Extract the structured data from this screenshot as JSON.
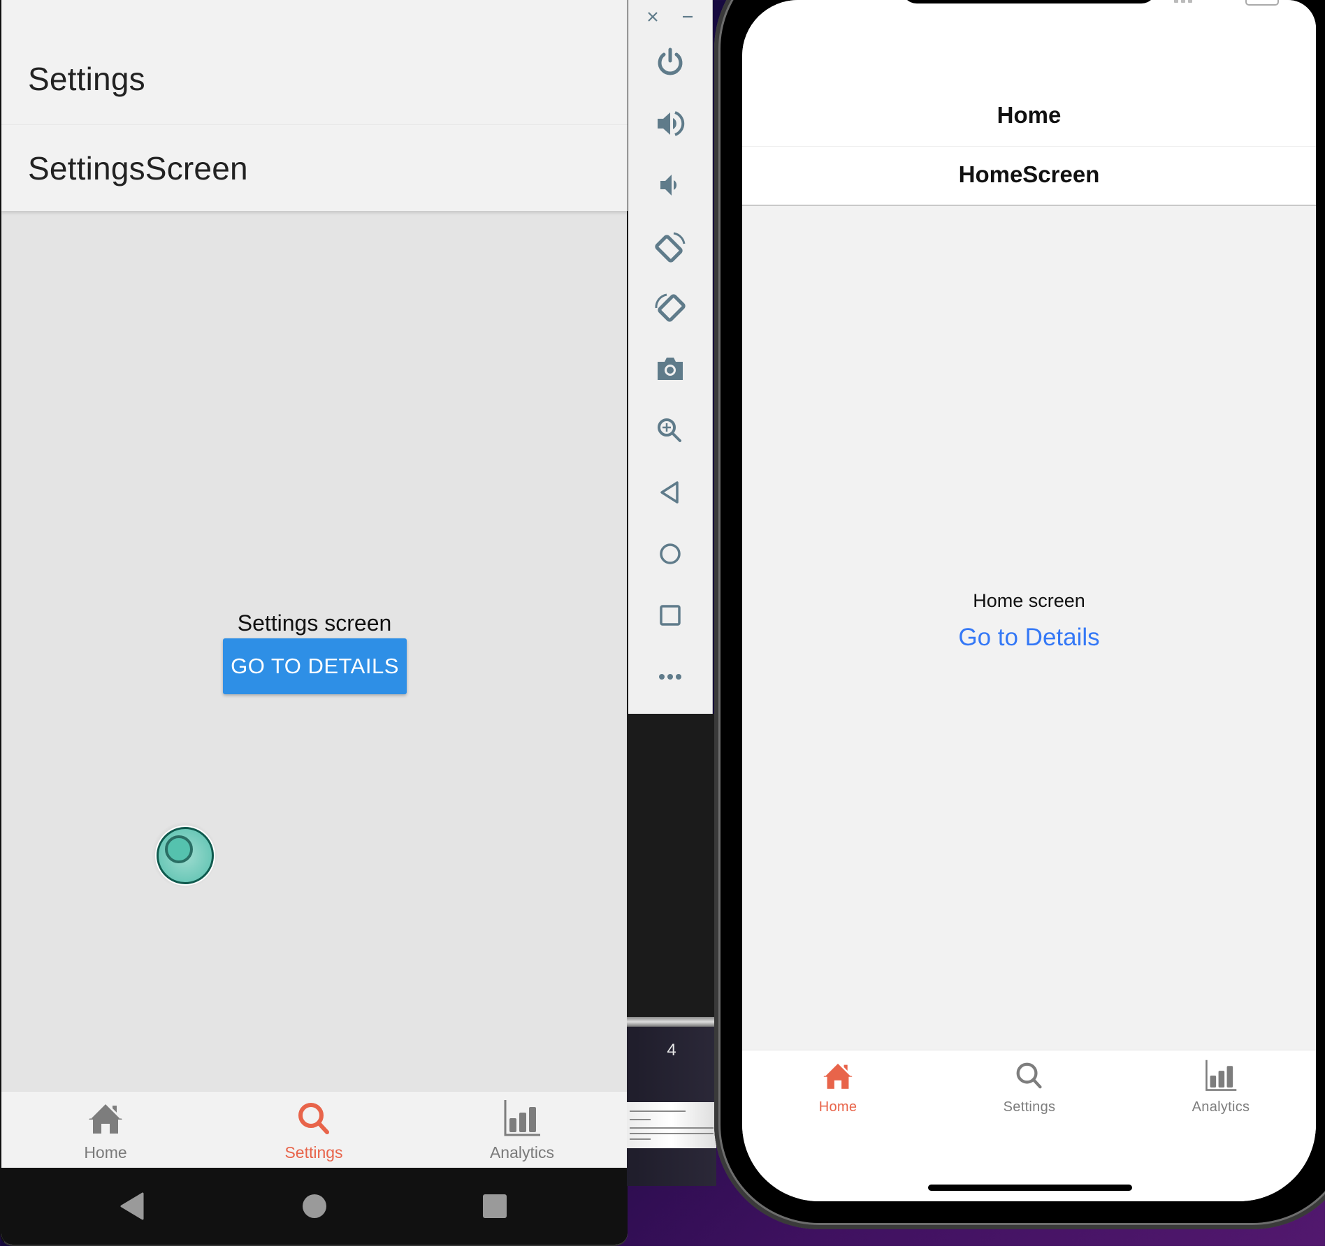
{
  "android": {
    "header": {
      "title": "Settings",
      "subtitle": "SettingsScreen"
    },
    "content": {
      "screen_label": "Settings screen",
      "go_button_label": "GO TO DETAILS"
    },
    "tabs": [
      {
        "label": "Home",
        "icon": "home-icon",
        "active": false
      },
      {
        "label": "Settings",
        "icon": "search-icon",
        "active": true
      },
      {
        "label": "Analytics",
        "icon": "bar-chart-icon",
        "active": false
      }
    ],
    "navbar": [
      "back-icon",
      "home-circle-icon",
      "recents-square-icon"
    ],
    "colors": {
      "accent": "#e8644a",
      "inactive": "#7a7a7a",
      "button": "#2e8fe6",
      "touch_indicator": "#5fc3b1"
    }
  },
  "emulator_toolbar": {
    "window_controls": [
      "close-icon",
      "minimize-icon"
    ],
    "buttons": [
      {
        "name": "power",
        "icon": "power-icon"
      },
      {
        "name": "volume-up",
        "icon": "volume-up-icon"
      },
      {
        "name": "volume-down",
        "icon": "volume-down-icon"
      },
      {
        "name": "rotate-left",
        "icon": "rotate-left-icon"
      },
      {
        "name": "rotate-right",
        "icon": "rotate-right-icon"
      },
      {
        "name": "screenshot",
        "icon": "camera-icon"
      },
      {
        "name": "zoom",
        "icon": "zoom-in-icon"
      },
      {
        "name": "back",
        "icon": "back-triangle-icon"
      },
      {
        "name": "home",
        "icon": "home-circle-icon"
      },
      {
        "name": "overview",
        "icon": "overview-square-icon"
      },
      {
        "name": "more",
        "icon": "more-dots-icon"
      }
    ],
    "icon_color": "#5f7b8a"
  },
  "background_window": {
    "page_number": "4"
  },
  "ios": {
    "header": {
      "title": "Home",
      "subtitle": "HomeScreen"
    },
    "content": {
      "screen_label": "Home screen",
      "go_link_label": "Go to Details"
    },
    "tabs": [
      {
        "label": "Home",
        "icon": "home-icon",
        "active": true
      },
      {
        "label": "Settings",
        "icon": "search-icon",
        "active": false
      },
      {
        "label": "Analytics",
        "icon": "bar-chart-icon",
        "active": false
      }
    ],
    "colors": {
      "accent": "#e8644a",
      "link": "#3478f6",
      "inactive": "#7d7d7d"
    }
  }
}
